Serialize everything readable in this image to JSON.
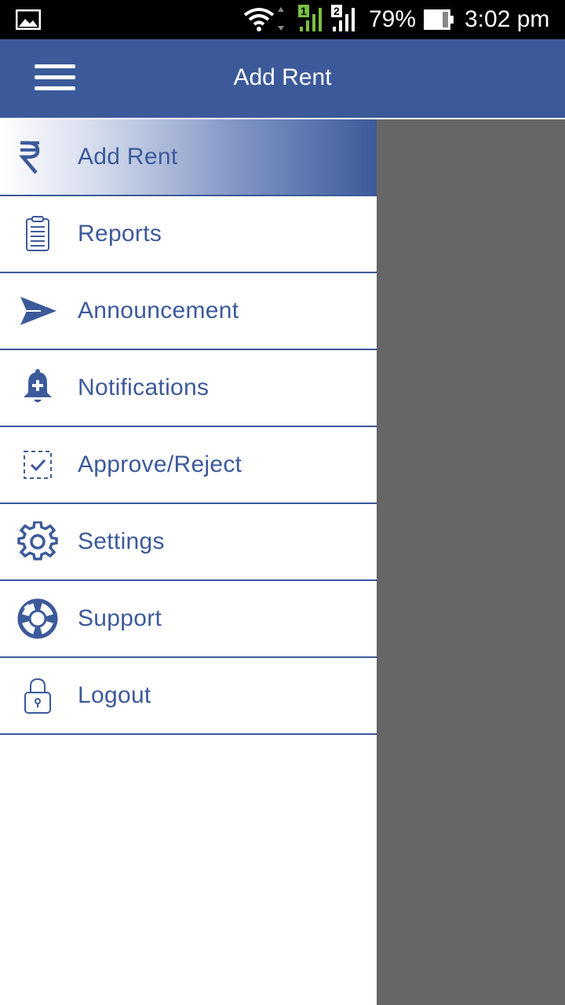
{
  "status_bar": {
    "battery": "79%",
    "time": "3:02 pm",
    "sim1": "1",
    "sim2": "2"
  },
  "app_bar": {
    "title": "Add Rent",
    "menu_icon": "hamburger-menu-icon"
  },
  "drawer": {
    "items": [
      {
        "label": "Add Rent",
        "icon": "rupee-icon",
        "active": true
      },
      {
        "label": "Reports",
        "icon": "clipboard-icon"
      },
      {
        "label": "Announcement",
        "icon": "send-icon"
      },
      {
        "label": "Notifications",
        "icon": "bell-icon"
      },
      {
        "label": "Approve/Reject",
        "icon": "checkbox-icon"
      },
      {
        "label": "Settings",
        "icon": "gear-icon"
      },
      {
        "label": "Support",
        "icon": "lifebuoy-icon"
      },
      {
        "label": "Logout",
        "icon": "lock-icon"
      }
    ]
  },
  "colors": {
    "primary": "#3c5a9a",
    "scrim": "#666666",
    "sim_signal": "#7ac143"
  }
}
